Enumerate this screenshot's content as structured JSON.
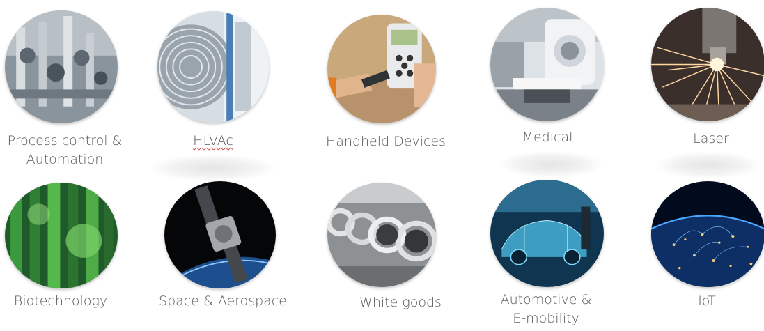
{
  "industries": [
    {
      "label_line1": "Process control &",
      "label_line2": "Automation",
      "icon": "industrial-valves-image"
    },
    {
      "label_line1": "HLVAc",
      "label_line2": "",
      "icon": "hvac-fan-image"
    },
    {
      "label_line1": "Handheld Devices",
      "label_line2": "",
      "icon": "handheld-device-image"
    },
    {
      "label_line1": "Medical",
      "label_line2": "",
      "icon": "medical-scanner-image"
    },
    {
      "label_line1": "Laser",
      "label_line2": "",
      "icon": "laser-sparks-image"
    },
    {
      "label_line1": "Biotechnology",
      "label_line2": "",
      "icon": "biotech-green-image"
    },
    {
      "label_line1": "Space & Aerospace",
      "label_line2": "",
      "icon": "spacecraft-image"
    },
    {
      "label_line1": "White goods",
      "label_line2": "",
      "icon": "washing-machines-image"
    },
    {
      "label_line1": "Automotive &",
      "label_line2": "E-mobility",
      "icon": "electric-car-image"
    },
    {
      "label_line1": "IoT",
      "label_line2": "",
      "icon": "iot-earth-network-image"
    }
  ],
  "colors": {
    "label_text": "#595959",
    "spellcheck_underline": "#d04040"
  }
}
